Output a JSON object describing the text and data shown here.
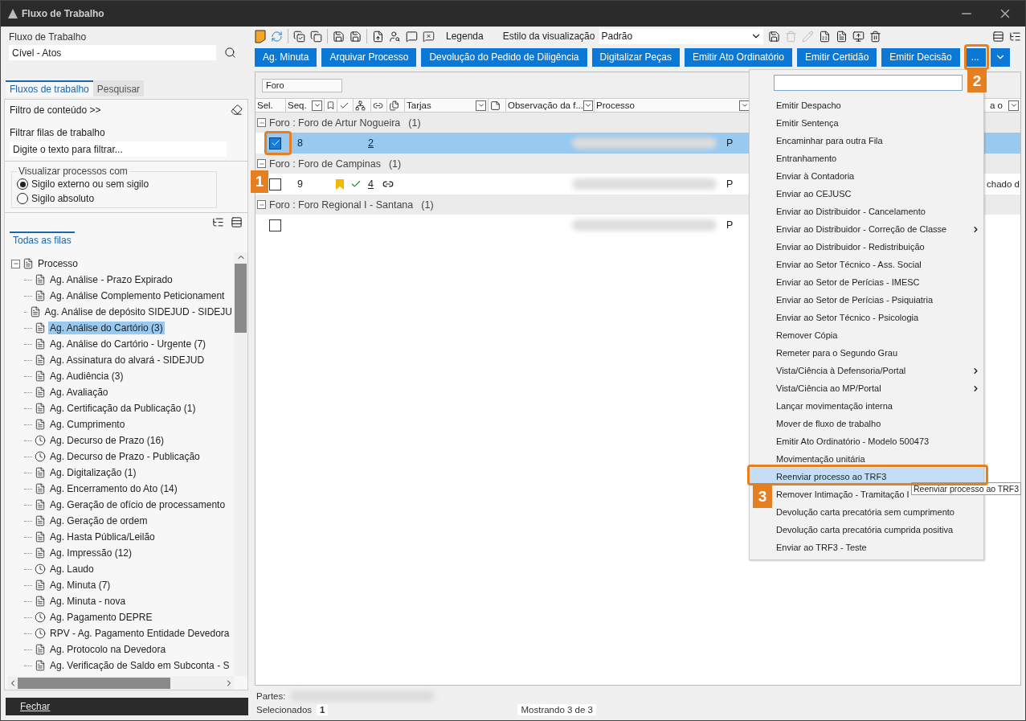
{
  "window": {
    "title": "Fluxo de Trabalho"
  },
  "left": {
    "flow_label": "Fluxo de Trabalho",
    "flow_value": "Cível - Atos",
    "tabs": [
      {
        "label": "Fluxos de trabalho",
        "selected": true
      },
      {
        "label": "Pesquisar",
        "selected": false
      }
    ],
    "filter_link": "Filtro de conteúdo >>",
    "filter_label": "Filtrar filas de trabalho",
    "filter_placeholder": "Digite o texto para filtrar...",
    "group_title": "Visualizar processos com",
    "radios": [
      {
        "label": "Sigilo externo ou sem sigilo",
        "selected": true
      },
      {
        "label": "Sigilo absoluto",
        "selected": false
      }
    ],
    "tree_tab": "Todas as filas",
    "tree": {
      "label": "Processo",
      "expanded": true,
      "children": [
        {
          "label": "Ag. Análise - Prazo Expirado",
          "kind": "doc",
          "selected": false
        },
        {
          "label": "Ag. Análise Complemento Peticionament",
          "kind": "doc",
          "selected": false
        },
        {
          "label": "Ag. Análise de depósito SIDEJUD - SIDEJU",
          "kind": "doc",
          "selected": false
        },
        {
          "label": "Ag. Análise do Cartório (3)",
          "kind": "doc",
          "selected": true
        },
        {
          "label": "Ag. Análise do Cartório - Urgente (7)",
          "kind": "doc",
          "selected": false
        },
        {
          "label": "Ag. Assinatura do alvará - SIDEJUD",
          "kind": "doc",
          "selected": false
        },
        {
          "label": "Ag. Audiência (3)",
          "kind": "doc",
          "selected": false
        },
        {
          "label": "Ag. Avaliação",
          "kind": "doc",
          "selected": false
        },
        {
          "label": "Ag. Certificação da Publicação (1)",
          "kind": "doc",
          "selected": false
        },
        {
          "label": "Ag. Cumprimento",
          "kind": "doc",
          "selected": false
        },
        {
          "label": "Ag. Decurso de Prazo (16)",
          "kind": "clock",
          "selected": false
        },
        {
          "label": "Ag. Decurso de Prazo - Publicação",
          "kind": "clock",
          "selected": false
        },
        {
          "label": "Ag. Digitalização (1)",
          "kind": "doc",
          "selected": false
        },
        {
          "label": "Ag. Encerramento do Ato (14)",
          "kind": "doc",
          "selected": false
        },
        {
          "label": "Ag. Geração de ofício de processamento",
          "kind": "doc",
          "selected": false
        },
        {
          "label": "Ag. Geração de ordem",
          "kind": "doc",
          "selected": false
        },
        {
          "label": "Ag. Hasta Pública/Leilão",
          "kind": "doc",
          "selected": false
        },
        {
          "label": "Ag. Impressão (12)",
          "kind": "doc",
          "selected": false
        },
        {
          "label": "Ag. Laudo",
          "kind": "clock",
          "selected": false
        },
        {
          "label": "Ag. Minuta (7)",
          "kind": "doc",
          "selected": false
        },
        {
          "label": "Ag. Minuta - nova",
          "kind": "doc",
          "selected": false
        },
        {
          "label": "Ag. Pagamento DEPRE",
          "kind": "clock",
          "selected": false
        },
        {
          "label": "RPV - Ag. Pagamento Entidade Devedora",
          "kind": "clock",
          "selected": false
        },
        {
          "label": "Ag. Protocolo na Devedora",
          "kind": "doc",
          "selected": false
        },
        {
          "label": "Ag. Verificação de Saldo em Subconta - S",
          "kind": "doc",
          "selected": false
        }
      ]
    },
    "close_button": "Fechar"
  },
  "toolbar": {
    "legend": "Legenda",
    "style_label": "Estilo da visualização",
    "style_value": "Padrão"
  },
  "actions": [
    "Ag. Minuta",
    "Arquivar Processo",
    "Devolução do Pedido de Diligência",
    "Digitalizar Peças",
    "Emitir Ato Ordinatório",
    "Emitir Certidão",
    "Emitir Decisão"
  ],
  "more_button": "...",
  "group_by": "Foro",
  "columns": [
    {
      "label": "Sel.",
      "filter": false
    },
    {
      "label": "Seq.",
      "filter": true
    },
    {
      "label": "Tarjas",
      "filter": true
    },
    {
      "label": "Observação da f...",
      "filter": true
    },
    {
      "label": "Processo",
      "filter": true
    },
    {
      "label": "a o",
      "filter": true
    }
  ],
  "groups": [
    {
      "label": "Foro : Foro de Artur Nogueira",
      "count": "(1)",
      "expanded": true,
      "rows": [
        {
          "checked": true,
          "selected": true,
          "seq": "8",
          "bookmark": false,
          "done": false,
          "number": "2",
          "linked": false,
          "column_c": "P",
          "last": ""
        }
      ]
    },
    {
      "label": "Foro : Foro de Campinas",
      "count": "(1)",
      "expanded": true,
      "rows": [
        {
          "checked": false,
          "selected": false,
          "seq": "9",
          "bookmark": true,
          "done": true,
          "number": "4",
          "linked": true,
          "column_c": "P",
          "last": "chado d"
        }
      ]
    },
    {
      "label": "Foro : Foro Regional I - Santana",
      "count": "(1)",
      "expanded": true,
      "rows": [
        {
          "checked": false,
          "selected": false,
          "seq": "",
          "bookmark": false,
          "done": false,
          "number": "",
          "linked": false,
          "column_c": "P",
          "last": ""
        }
      ]
    }
  ],
  "status": {
    "parts_label": "Partes:",
    "selected_label": "Selecionados",
    "selected_count": "1",
    "showing": "Mostrando 3 de 3"
  },
  "menu": {
    "items": [
      {
        "label": "Emitir Despacho",
        "submenu": false,
        "selected": false
      },
      {
        "label": "Emitir Sentença",
        "submenu": false,
        "selected": false
      },
      {
        "label": "Encaminhar para outra Fila",
        "submenu": false,
        "selected": false
      },
      {
        "label": "Entranhamento",
        "submenu": false,
        "selected": false
      },
      {
        "label": "Enviar à Contadoria",
        "submenu": false,
        "selected": false
      },
      {
        "label": "Enviar ao CEJUSC",
        "submenu": false,
        "selected": false
      },
      {
        "label": "Enviar ao Distribuidor - Cancelamento",
        "submenu": false,
        "selected": false
      },
      {
        "label": "Enviar ao Distribuidor - Correção de Classe",
        "submenu": true,
        "selected": false
      },
      {
        "label": "Enviar ao Distribuidor - Redistribuição",
        "submenu": false,
        "selected": false
      },
      {
        "label": "Enviar ao Setor Técnico - Ass. Social",
        "submenu": false,
        "selected": false
      },
      {
        "label": "Enviar ao Setor de Perícias - IMESC",
        "submenu": false,
        "selected": false
      },
      {
        "label": "Enviar ao Setor de Perícias - Psiquiatria",
        "submenu": false,
        "selected": false
      },
      {
        "label": "Enviar ao Setor Técnico - Psicologia",
        "submenu": false,
        "selected": false
      },
      {
        "label": "Remover Cópia",
        "submenu": false,
        "selected": false
      },
      {
        "label": "Remeter para o Segundo Grau",
        "submenu": false,
        "selected": false
      },
      {
        "label": "Vista/Ciência à Defensoria/Portal",
        "submenu": true,
        "selected": false
      },
      {
        "label": "Vista/Ciência ao MP/Portal",
        "submenu": true,
        "selected": false
      },
      {
        "label": "Lançar movimentação interna",
        "submenu": false,
        "selected": false
      },
      {
        "label": "Mover de fluxo de trabalho",
        "submenu": false,
        "selected": false
      },
      {
        "label": "Emitir Ato Ordinatório - Modelo 500473",
        "submenu": false,
        "selected": false
      },
      {
        "label": "Movimentação unitária",
        "submenu": false,
        "selected": false
      },
      {
        "label": "Reenviar processo ao TRF3",
        "submenu": false,
        "selected": true
      },
      {
        "label": "Remover Intimação - Tramitação I",
        "submenu": false,
        "selected": false
      },
      {
        "label": "Devolução carta precatória sem cumprimento",
        "submenu": false,
        "selected": false
      },
      {
        "label": "Devolução carta precatória cumprida positiva",
        "submenu": false,
        "selected": false
      },
      {
        "label": "Enviar ao TRF3 - Teste",
        "submenu": false,
        "selected": false
      }
    ],
    "tooltip": "Reenviar processo ao TRF3"
  },
  "callouts": [
    "1",
    "2",
    "3"
  ]
}
